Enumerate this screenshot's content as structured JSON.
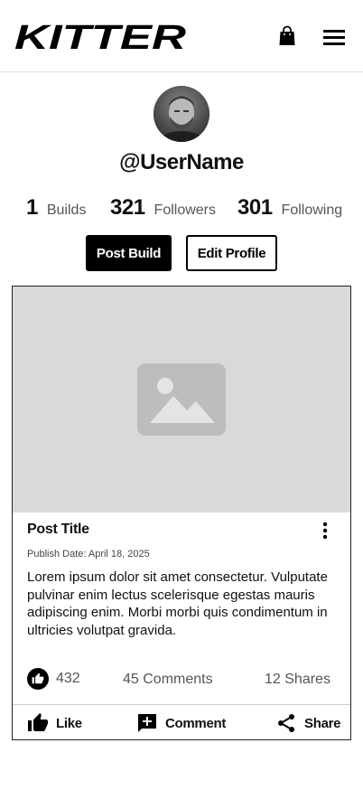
{
  "header": {
    "logo_text": "KITTER",
    "bag_icon": "shopping-bag-icon",
    "menu_icon": "hamburger-menu-icon"
  },
  "profile": {
    "username": "@UserName",
    "stats": [
      {
        "value": "1",
        "label": "Builds"
      },
      {
        "value": "321",
        "label": "Followers"
      },
      {
        "value": "301",
        "label": "Following"
      }
    ],
    "post_build_label": "Post Build",
    "edit_profile_label": "Edit Profile"
  },
  "post": {
    "image_icon": "image-placeholder-icon",
    "title": "Post Title",
    "publish_date": "Publish Date: April 18, 2025",
    "body": "Lorem ipsum dolor sit amet consectetur. Vulputate pulvinar enim lectus scelerisque egestas mauris adipiscing enim. Morbi morbi quis condimentum in ultricies volutpat gravida.",
    "likes": "432",
    "comments": "45 Comments",
    "shares": "12 Shares",
    "actions": {
      "like": "Like",
      "comment": "Comment",
      "share": "Share"
    }
  },
  "colors": {
    "primary": "#000000",
    "image_placeholder": "#d9d9d9",
    "muted_text": "#555555"
  }
}
